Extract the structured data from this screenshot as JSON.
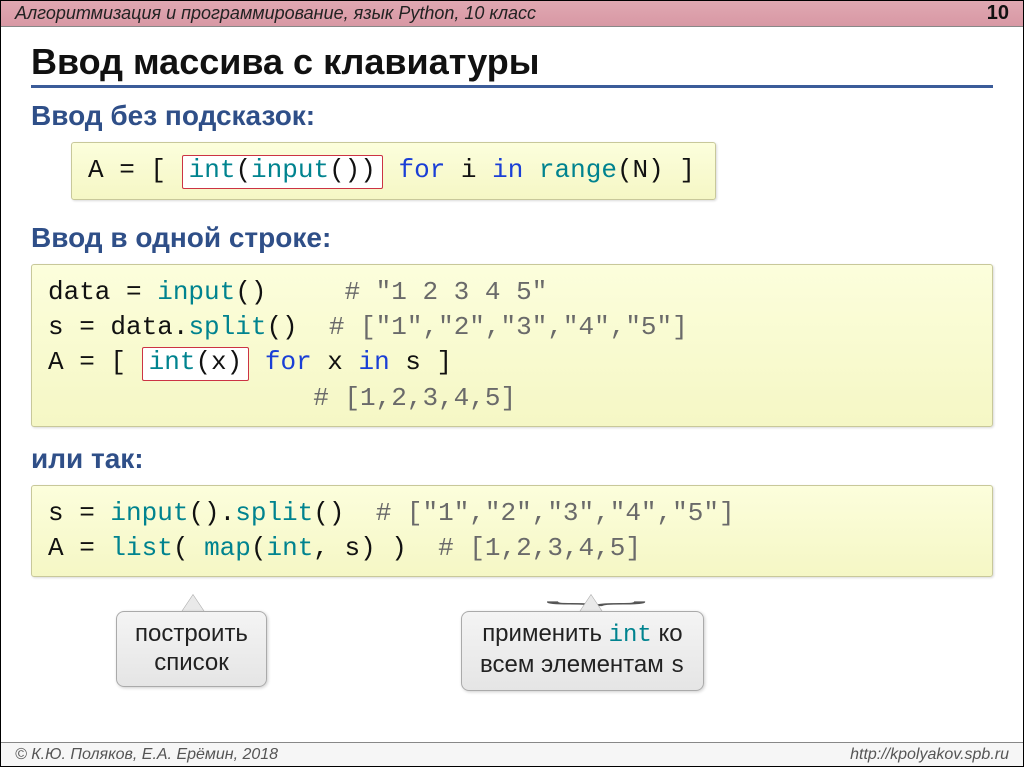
{
  "header": {
    "title": "Алгоритмизация и программирование, язык Python, 10 класс",
    "page": "10"
  },
  "title": "Ввод массива с клавиатуры",
  "section1": {
    "heading": "Ввод без подсказок:",
    "code": {
      "pre": "A = [ ",
      "boxed_func": "int",
      "boxed_open": "(",
      "boxed_input": "input",
      "boxed_close": "())",
      "space": " ",
      "for": "for",
      "i": " i ",
      "in": "in",
      "range": " range",
      "tail": "(N) ]"
    }
  },
  "section2": {
    "heading": "Ввод в одной строке:",
    "code": {
      "l1a": "data = ",
      "l1b": "input",
      "l1c": "()",
      "l1d": "     # \"1 2 3 4 5\"",
      "l2a": "s = data.",
      "l2b": "split",
      "l2c": "()",
      "l2d": "  # [\"1\",\"2\",\"3\",\"4\",\"5\"]",
      "l3a": "A = [ ",
      "l3box_a": "int",
      "l3box_b": "(x)",
      "l3c": " ",
      "l3d": "for",
      "l3e": " x ",
      "l3f": "in",
      "l3g": " s ]",
      "l4": "                 # [1,2,3,4,5]"
    }
  },
  "section3": {
    "heading": "или так:",
    "code": {
      "l1a": "s = ",
      "l1b": "input",
      "l1c": "().",
      "l1d": "split",
      "l1e": "()",
      "l1f": "  # [\"1\",\"2\",\"3\",\"4\",\"5\"]",
      "l2a": "A = ",
      "l2b": "list",
      "l2c": "( ",
      "l2d": "map",
      "l2e": "(",
      "l2f": "int",
      "l2g": ", s) )",
      "l2h": "  # [1,2,3,4,5]"
    }
  },
  "callouts": {
    "left_line1": "построить",
    "left_line2": "список",
    "right_pre": "применить ",
    "right_code": "int",
    "right_post": " ко",
    "right_line2": "всем элементам ",
    "right_s": "s"
  },
  "footer": {
    "left": "© К.Ю. Поляков, Е.А. Ерёмин, 2018",
    "right": "http://kpolyakov.spb.ru"
  }
}
